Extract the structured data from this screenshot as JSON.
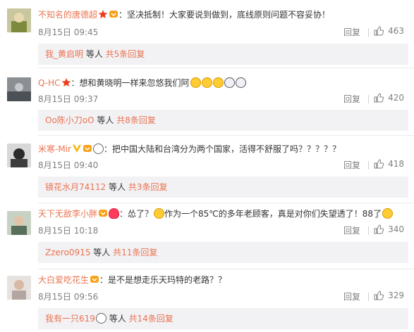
{
  "comments": [
    {
      "username": "不知名的唐德超",
      "text": "：坚决抵制！大家要说到做到，底线原则问题不容妥协！",
      "time": "8月15日 09:45",
      "reply_label": "回复",
      "likes": "463",
      "sub": {
        "user": "我_黄启明",
        "text": " 等人 ",
        "count": "共5条回复"
      }
    },
    {
      "username": "Q-HC",
      "text": "：想和黄晓明一样来忽悠我们阿",
      "time": "8月15日 09:37",
      "reply_label": "回复",
      "likes": "420",
      "sub": {
        "user": "Oo陈小刀oO",
        "text": " 等人 ",
        "count": "共8条回复"
      }
    },
    {
      "username": "米寒-Mir",
      "text": "：把中国大陆和台湾分为两个国家，活得不舒服了吗？？？？？",
      "time": "8月15日 09:40",
      "reply_label": "回复",
      "likes": "418",
      "sub": {
        "user": "镜花水月74112",
        "text": " 等人 ",
        "count": "共3条回复"
      }
    },
    {
      "username": "天下无敌李小胖",
      "text_a": "：怂了？",
      "text_b": "作为一个85℃的多年老顾客，真是对你们失望透了！88了",
      "time": "8月15日 10:18",
      "reply_label": "回复",
      "likes": "340",
      "sub": {
        "user": "Zzero0915",
        "text": " 等人 ",
        "count": "共11条回复"
      }
    },
    {
      "username": "大白爱吃花生",
      "text": "：是不是想走乐天玛特的老路？？",
      "time": "8月15日 09:56",
      "reply_label": "回复",
      "likes": "329",
      "sub": {
        "user": "我有一只619",
        "text": " 等人 ",
        "count": "共14条回复"
      }
    }
  ],
  "colors": {
    "username": "#eb7350",
    "meta": "#808080",
    "subbox_bg": "#f2f2f5"
  }
}
